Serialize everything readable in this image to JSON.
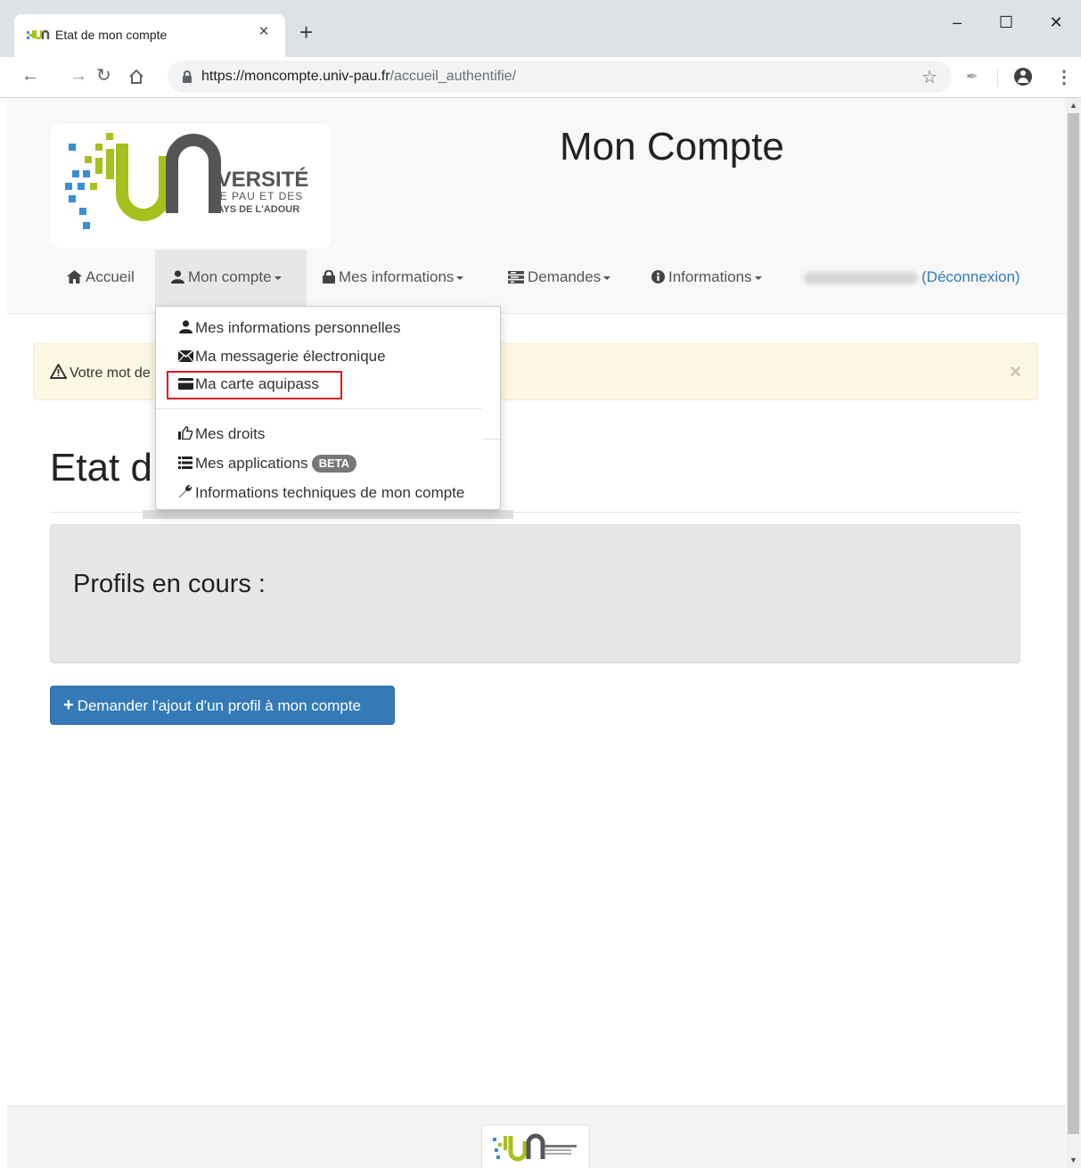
{
  "browser": {
    "tab_title": "Etat de mon compte",
    "tab_close": "×",
    "new_tab": "+",
    "url_host": "https://moncompte.univ-pau.fr",
    "url_path": "/accueil_authentifie/",
    "window_controls": {
      "minimize": "–",
      "maximize": "☐",
      "close": "✕"
    }
  },
  "header": {
    "site_title": "Mon Compte",
    "logo_text": {
      "line1": "IVERSITÉ",
      "line2": "DE PAU ET DES",
      "line3": "PAYS DE L'ADOUR"
    }
  },
  "nav": {
    "items": [
      {
        "label": "Accueil",
        "icon": "home-icon"
      },
      {
        "label": "Mon compte",
        "icon": "user-icon"
      },
      {
        "label": "Mes informations",
        "icon": "lock-icon"
      },
      {
        "label": "Demandes",
        "icon": "tasks-icon"
      },
      {
        "label": "Informations",
        "icon": "info-icon"
      }
    ],
    "logout": "(Déconnexion)"
  },
  "dropdown": {
    "items": [
      {
        "label": "Mes informations personnelles",
        "icon": "user-icon"
      },
      {
        "label": "Ma messagerie électronique",
        "icon": "envelope-icon"
      },
      {
        "label": "Ma carte aquipass",
        "icon": "credit-card-icon"
      },
      {
        "label": "Mes droits",
        "icon": "thumbs-up-icon"
      },
      {
        "label": "Mes applications",
        "icon": "list-icon",
        "badge": "BETA"
      },
      {
        "label": "Informations techniques de mon compte",
        "icon": "wrench-icon"
      }
    ],
    "highlight_color": "#e0141c"
  },
  "alert": {
    "text": "Votre mot de",
    "close": "×"
  },
  "main": {
    "heading": "Etat d",
    "well_title": "Profils en cours :",
    "add_profile_button": "Demander l'ajout d'un profil à mon compte"
  },
  "colors": {
    "primary": "#337ab7",
    "alert_bg": "#fcf8e3",
    "logo_green": "#a6c11d",
    "logo_blue": "#3a8fd1"
  }
}
